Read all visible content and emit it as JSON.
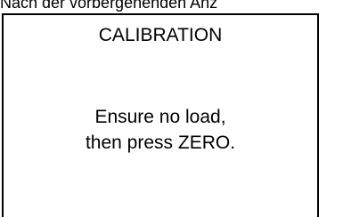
{
  "page": {
    "caption": "Nach der vorbergehenden Anz"
  },
  "screen": {
    "title": "CALIBRATION",
    "message_line1": "Ensure no load,",
    "message_line2": "then press ZERO."
  },
  "colors": {
    "background": "#ffffff",
    "text": "#000000",
    "border": "#000000"
  }
}
